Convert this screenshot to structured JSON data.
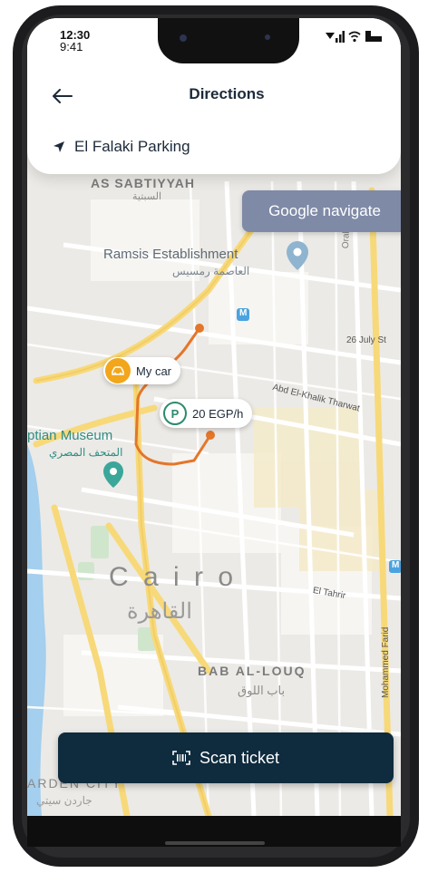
{
  "status_bar": {
    "time_primary": "12:30",
    "time_secondary": "9:41"
  },
  "header": {
    "back_icon": "arrow-left-icon",
    "title": "Directions"
  },
  "destination": {
    "icon": "navigation-arrow-icon",
    "label": "El Falaki Parking"
  },
  "google_navigate": {
    "label": "Google navigate"
  },
  "markers": {
    "car": {
      "label": "My car",
      "icon": "car-icon"
    },
    "parking": {
      "symbol": "P",
      "rate": "20 EGP/h"
    }
  },
  "map_labels": {
    "district_top_latin": "AS SABTIYYAH",
    "district_top_arabic": "السبتية",
    "ramsis_latin": "Ramsis Establishment",
    "ramsis_arabic": "العاصمة رمسيس",
    "oraby": "Oraby",
    "july_street": "26 July St",
    "abd_khalik": "Abd El-Khalik Tharwat",
    "museum_latin": "ptian Museum",
    "museum_arabic": "المتحف المصري",
    "cairo_latin": "C a i r o",
    "cairo_arabic": "القاهرة",
    "el_tahrir": "El Tahrir",
    "bab_latin": "BAB AL-LOUQ",
    "bab_arabic": "باب اللوق",
    "mohammed_farid": "Mohammed Farid",
    "garden_latin": "ARDEN CITY",
    "garden_arabic": "جاردن سيتي",
    "metro_symbol": "M"
  },
  "scan_button": {
    "icon": "scan-icon",
    "label": "Scan ticket"
  },
  "colors": {
    "primary_dark": "#0f2b3e",
    "google_button": "#7f8aa7",
    "car_marker": "#f2a61c",
    "parking_green": "#2d8a6e",
    "route": "#e4762a",
    "road_yellow": "#f7d97a"
  }
}
